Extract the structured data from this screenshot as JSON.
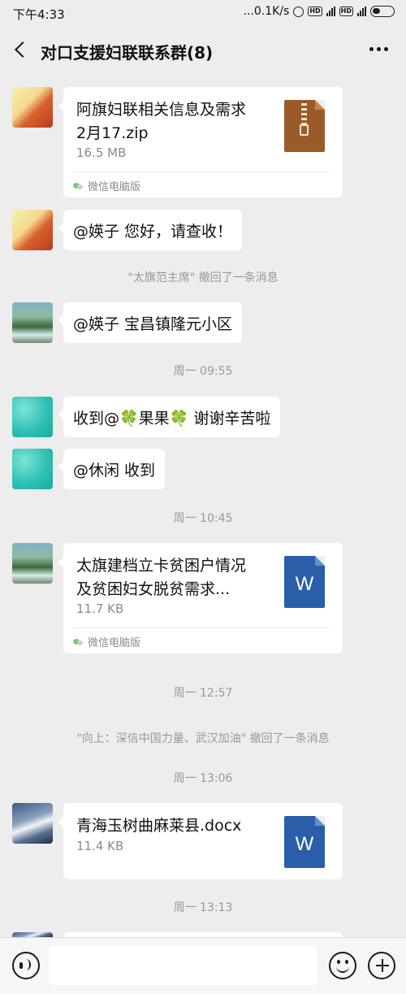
{
  "status_bar": {
    "time": "下午4:33",
    "network_speed": "...0.1K/s"
  },
  "header": {
    "title": "对口支援妇联联系群(8)"
  },
  "messages": [
    {
      "type": "file",
      "file_name": "阿旗妇联相关信息及需求2月17.zip",
      "file_name_line1": "阿旗妇联相关信息及需求",
      "file_name_line2": "2月17.zip",
      "size": "16.5 MB",
      "source": "微信电脑版",
      "file_icon": "zip-icon"
    },
    {
      "type": "text",
      "text": "@媖子  您好，请查收！"
    },
    {
      "type": "system",
      "text": "\"太旗范主席\" 撤回了一条消息"
    },
    {
      "type": "text",
      "text": "@媖子  宝昌镇隆元小区"
    },
    {
      "type": "time",
      "text": "周一 09:55"
    },
    {
      "type": "text",
      "text": "收到@🍀果果🍀 谢谢辛苦啦"
    },
    {
      "type": "text",
      "text": "@休闲  收到"
    },
    {
      "type": "time",
      "text": "周一 10:45"
    },
    {
      "type": "file",
      "file_name_line1": "太旗建档立卡贫困户情况",
      "file_name_line2": "及贫困妇女脱贫需求...",
      "size": "11.7 KB",
      "source": "微信电脑版",
      "file_icon": "word-icon",
      "icon_letter": "W"
    },
    {
      "type": "time",
      "text": "周一 12:57"
    },
    {
      "type": "system",
      "text": "\"向上：深信中国力量、武汉加油\" 撤回了一条消息"
    },
    {
      "type": "time",
      "text": "周一 13:06"
    },
    {
      "type": "file",
      "file_name_line1": "青海玉树曲麻莱县.docx",
      "size": "11.4 KB",
      "file_icon": "word-icon",
      "icon_letter": "W"
    },
    {
      "type": "time",
      "text": "周一 13:13"
    }
  ],
  "input_bar": {
    "placeholder": ""
  }
}
